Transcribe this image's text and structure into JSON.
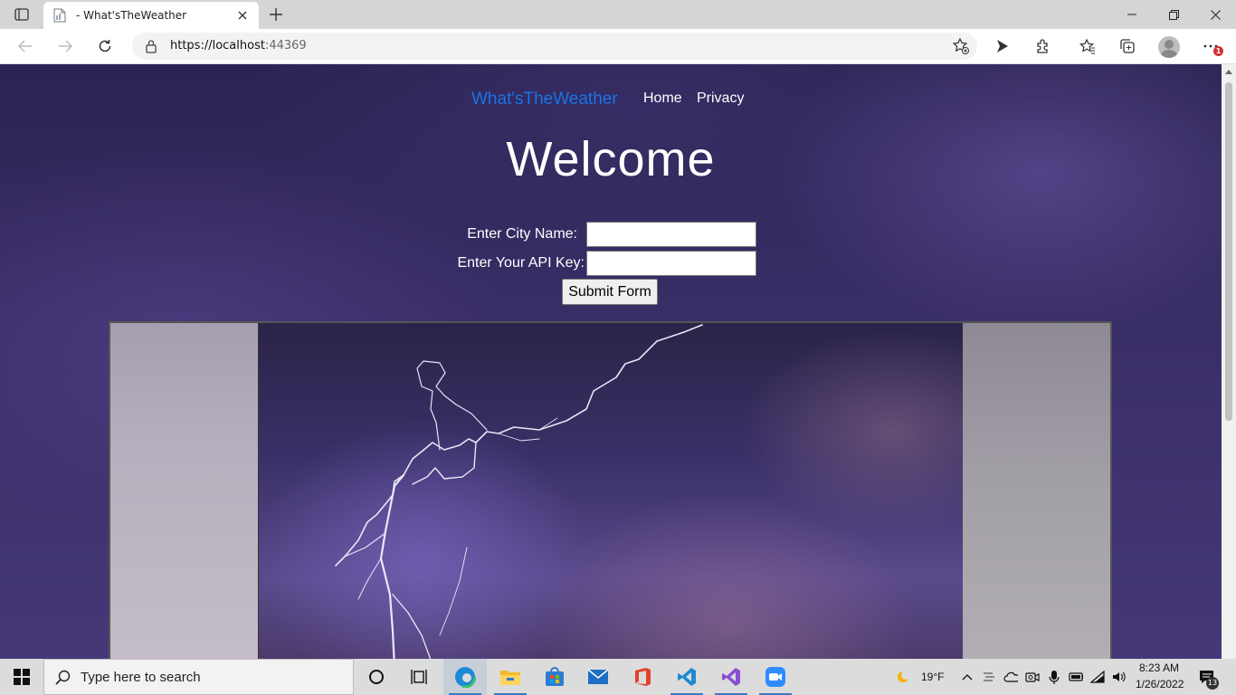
{
  "browser": {
    "tab_title": "- What'sTheWeather",
    "url_host": "https://localhost",
    "url_rest": ":44369",
    "notification_count": "1"
  },
  "page": {
    "brand": "What'sTheWeather",
    "nav": [
      "Home",
      "Privacy"
    ],
    "heading": "Welcome",
    "form": {
      "city_label": "Enter City Name:",
      "city_value": "",
      "api_label": "Enter Your API Key:",
      "api_value": "",
      "submit_label": "Submit Form"
    }
  },
  "taskbar": {
    "search_placeholder": "Type here to search",
    "weather_temp": "19°F",
    "time": "8:23 AM",
    "date": "1/26/2022",
    "notifications": "13",
    "apps": [
      "task-view",
      "file-explorer",
      "edge",
      "microsoft-store",
      "mail",
      "office",
      "vs-code",
      "visual-studio",
      "zoom"
    ]
  },
  "colors": {
    "brand": "#1a73e8",
    "page_bg": "#3a2e68"
  }
}
